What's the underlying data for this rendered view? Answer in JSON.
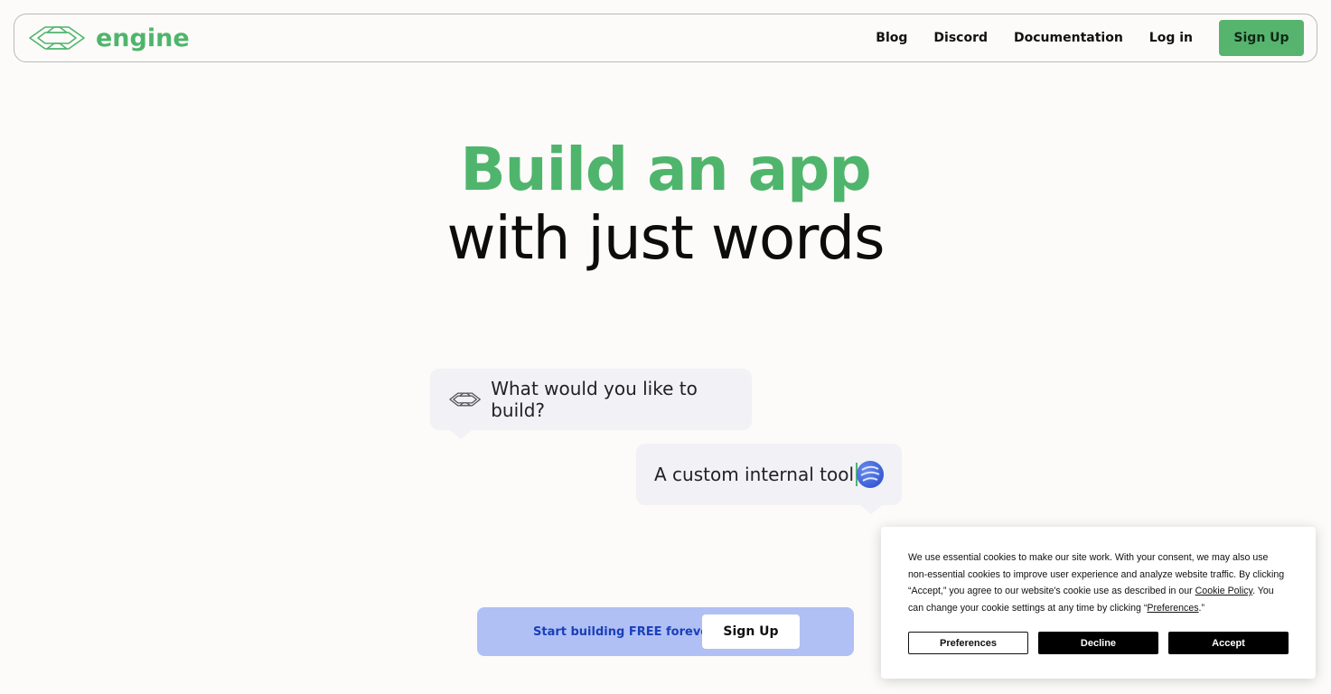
{
  "brand": {
    "name": "engine",
    "logo_icon": "double-chevron-logo-icon",
    "color": "#4fb56c"
  },
  "nav": {
    "links": [
      "Blog",
      "Discord",
      "Documentation",
      "Log in"
    ],
    "signup_label": "Sign Up",
    "signup_color": "#57b46e"
  },
  "hero": {
    "line1": "Build an app",
    "line2": "with just words",
    "accent_color": "#4fb56c"
  },
  "chat": {
    "question": "What would you like to build?",
    "question_icon": "double-chevron-icon",
    "answer": "A custom internal tool",
    "answer_avatar": "user-avatar-icon"
  },
  "cta": {
    "text": "Start building FREE forever",
    "button_label": "Sign Up",
    "bg_color": "#b0c0f5",
    "text_color": "#1a3fb8"
  },
  "cookie": {
    "text_part1": "We use essential cookies to make our site work. With your consent, we may also use non-essential cookies to improve user experience and analyze website traffic. By clicking “Accept,” you agree to our website's cookie use as described in our ",
    "policy_link": "Cookie Policy",
    "text_part2": ". You can change your cookie settings at any time by clicking “",
    "preferences_link": "Preferences",
    "text_part3": ".”",
    "buttons": {
      "preferences": "Preferences",
      "decline": "Decline",
      "accept": "Accept"
    }
  }
}
